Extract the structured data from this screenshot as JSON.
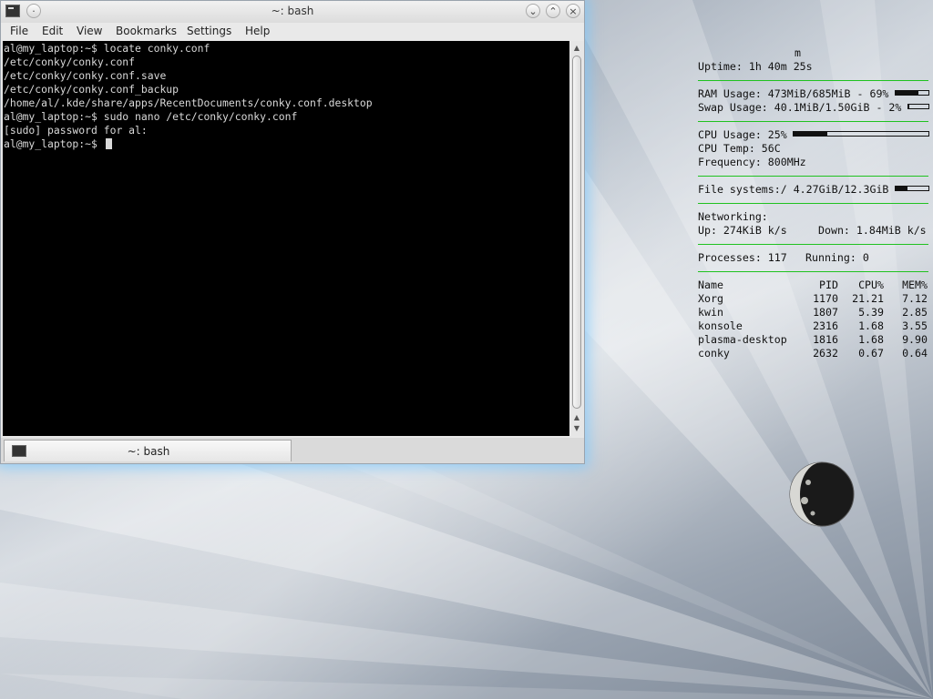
{
  "window": {
    "title": "~: bash",
    "menu": [
      "File",
      "Edit",
      "View",
      "Bookmarks",
      "Settings",
      "Help"
    ],
    "tab_label": "~: bash"
  },
  "terminal": {
    "lines": [
      "al@my_laptop:~$ locate conky.conf",
      "/etc/conky/conky.conf",
      "/etc/conky/conky.conf.save",
      "/etc/conky/conky.conf_backup",
      "/home/al/.kde/share/apps/RecentDocuments/conky.conf.desktop",
      "al@my_laptop:~$ sudo nano /etc/conky/conky.conf",
      "[sudo] password for al:",
      "al@my_laptop:~$ "
    ]
  },
  "conky": {
    "header": "m",
    "uptime": "Uptime: 1h 40m 25s",
    "ram": "RAM Usage: 473MiB/685MiB - 69%",
    "ram_pct": 69,
    "swap": "Swap Usage: 40.1MiB/1.50GiB - 2%",
    "swap_pct": 2,
    "cpu_usage": "CPU Usage: 25%",
    "cpu_pct": 25,
    "cpu_temp": "CPU Temp: 56C",
    "frequency": "Frequency: 800MHz",
    "filesystems": "File systems:/ 4.27GiB/12.3GiB",
    "fs_pct": 35,
    "networking": "Networking:",
    "up": "Up: 274KiB k/s",
    "down": "Down: 1.84MiB k/s",
    "processes": "Processes: 117",
    "running": "Running: 0",
    "proc_headers": [
      "Name",
      "PID",
      "CPU%",
      "MEM%"
    ],
    "procs": [
      [
        "Xorg",
        "1170",
        "21.21",
        "7.12"
      ],
      [
        "kwin",
        "1807",
        "5.39",
        "2.85"
      ],
      [
        "konsole",
        "2316",
        "1.68",
        "3.55"
      ],
      [
        "plasma-desktop",
        "1816",
        "1.68",
        "9.90"
      ],
      [
        "conky",
        "2632",
        "0.67",
        "0.64"
      ]
    ],
    "accent": "#1fc21f"
  }
}
